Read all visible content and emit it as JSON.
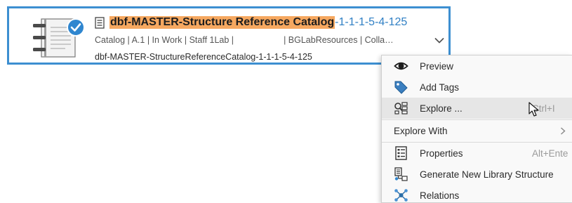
{
  "card": {
    "title_highlight": "dbf-MASTER-Structure Reference Catalog",
    "title_suffix": "-1-1-1-5-4-125",
    "attributes_left": "Catalog | A.1 | In Work | Staff 1Lab |",
    "attributes_right": "| BGLabResources | Colla…",
    "identifier": "dbf-MASTER-StructureReferenceCatalog-1-1-1-5-4-125"
  },
  "menu": {
    "preview": {
      "label": "Preview",
      "icon": "eye-icon"
    },
    "add_tags": {
      "label": "Add Tags",
      "icon": "tag-icon"
    },
    "explore": {
      "label": "Explore ...",
      "shortcut": "Ctrl+I",
      "icon": "explore-icon"
    },
    "explore_with": {
      "label": "Explore With",
      "icon": "chevron-right-icon"
    },
    "properties": {
      "label": "Properties",
      "shortcut": "Alt+Ente",
      "icon": "properties-icon"
    },
    "generate": {
      "label": "Generate New Library Structure",
      "icon": "library-structure-icon"
    },
    "relations": {
      "label": "Relations",
      "icon": "relations-icon"
    }
  },
  "colors": {
    "card_border": "#3d8fd1",
    "highlight": "#f6a860",
    "title_link": "#2f7fc4",
    "menu_hover": "#e6e6e6"
  }
}
